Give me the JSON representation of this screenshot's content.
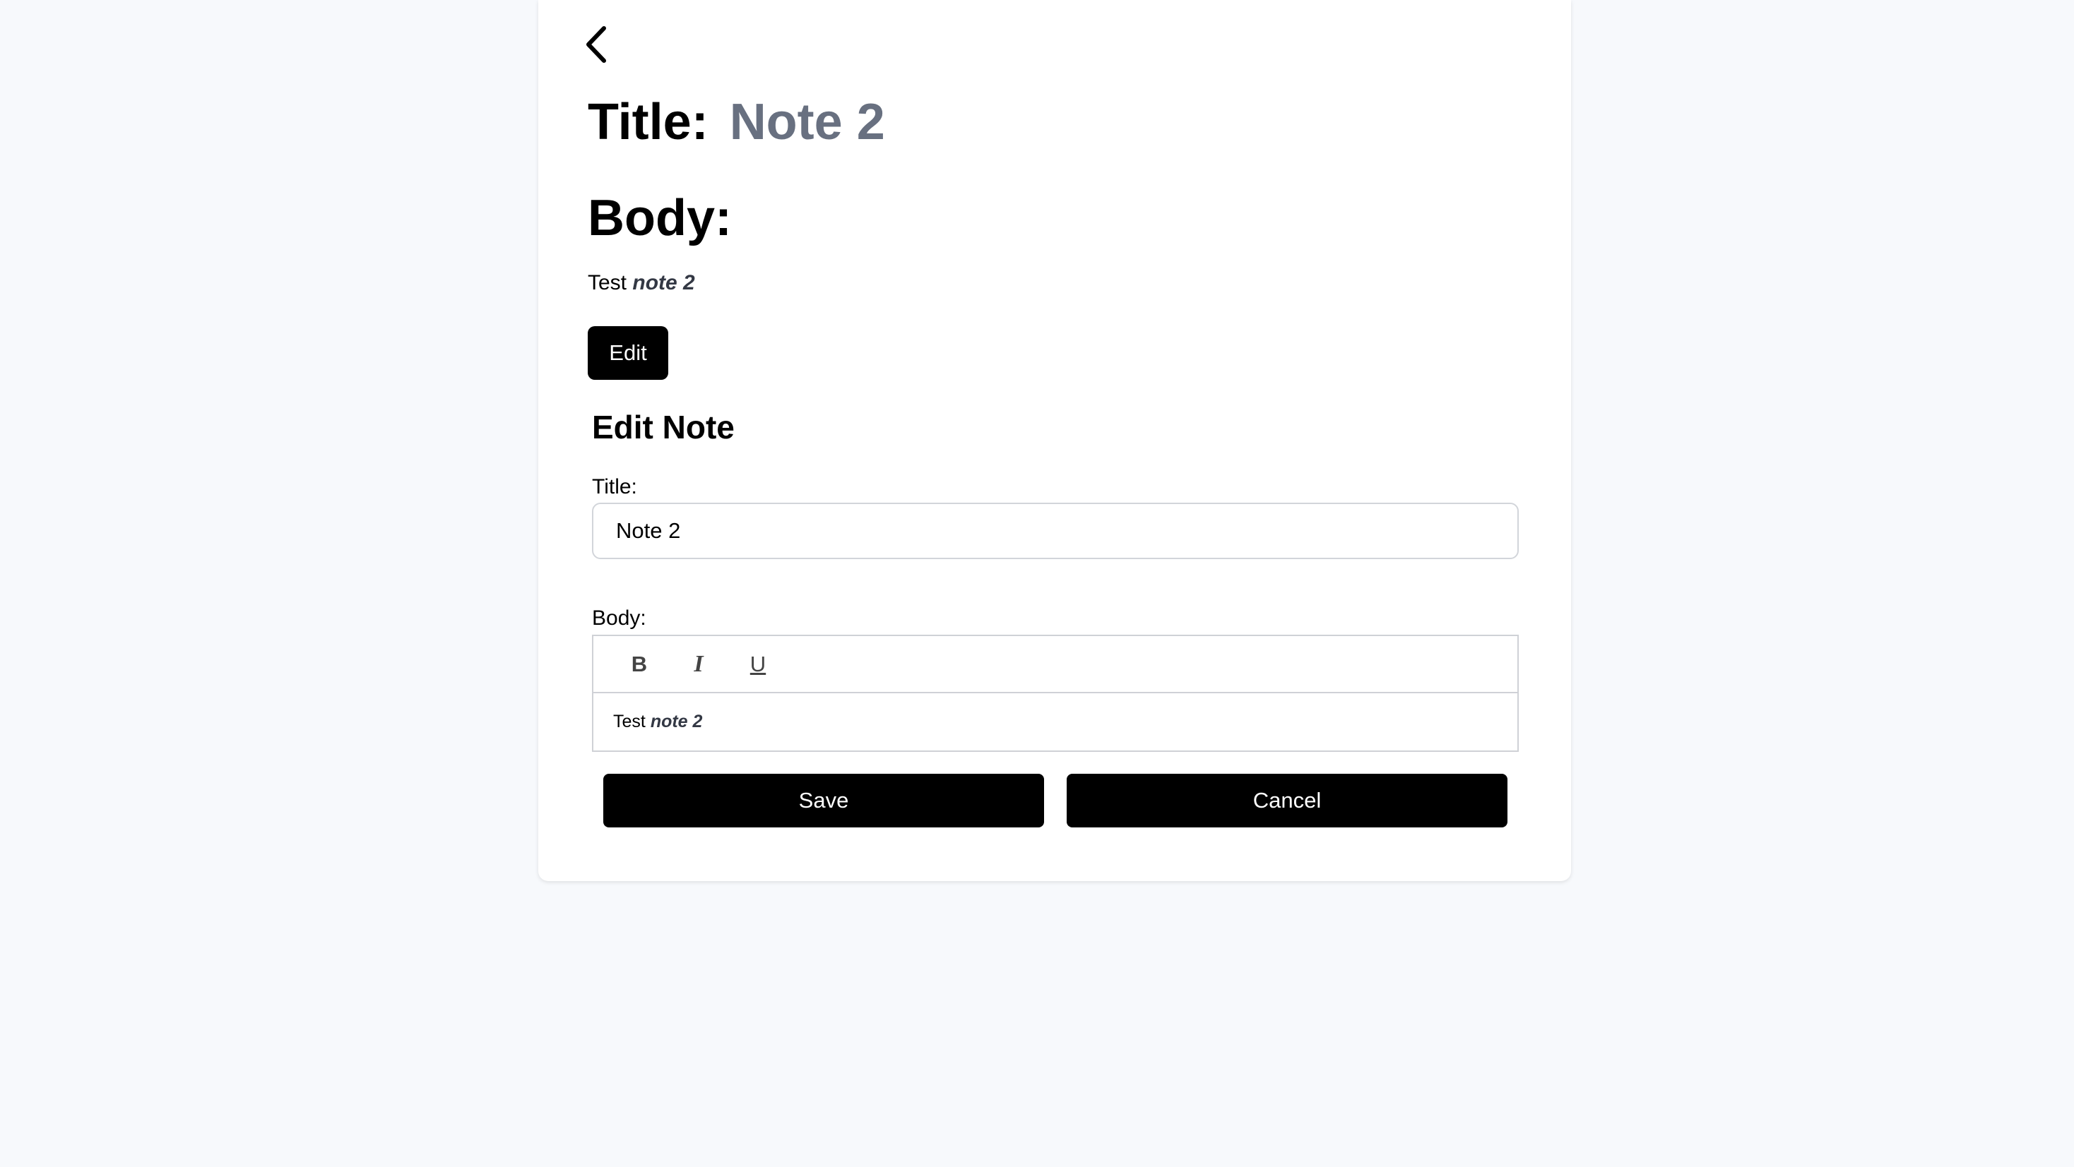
{
  "view": {
    "title_label": "Title:",
    "title_value": "Note 2",
    "body_heading": "Body:",
    "body_text_plain": "Test",
    "body_text_emphasis": "note 2",
    "edit_label": "Edit"
  },
  "edit_form": {
    "heading": "Edit Note",
    "title_label": "Title:",
    "title_value": "Note 2",
    "body_label": "Body:",
    "toolbar": {
      "bold": "B",
      "italic": "I",
      "underline": "U"
    },
    "body_text_plain": "Test",
    "body_text_emphasis": "note 2",
    "save_label": "Save",
    "cancel_label": "Cancel"
  },
  "icons": {
    "back": "chevron-left-icon"
  },
  "colors": {
    "page_background": "#f7f9fc",
    "title_value": "#687080",
    "button_background": "#000000",
    "button_text": "#ffffff"
  }
}
